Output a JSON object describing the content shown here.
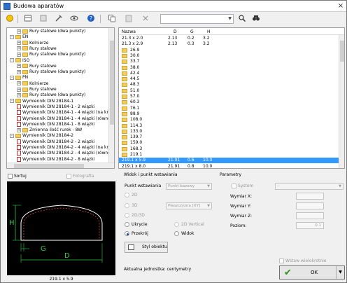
{
  "window": {
    "title": "Budowa aparatów",
    "close_glyph": "×"
  },
  "toolbar": {
    "icons": [
      "star-add-icon",
      "table-icon",
      "list-icon",
      "tools-icon",
      "view-icon",
      "help-icon",
      "copy-icon",
      "paste-icon",
      "delete-icon",
      "search-icon",
      "binoculars-icon"
    ],
    "combo_value": ""
  },
  "tree": {
    "items": [
      {
        "label": "Rury stalowe (dwa punkty)",
        "indent": 1,
        "type": "folder",
        "exp": "+"
      },
      {
        "label": "EN",
        "indent": 0,
        "type": "folder",
        "exp": "-"
      },
      {
        "label": "Kolnierze",
        "indent": 1,
        "type": "folder",
        "exp": "+"
      },
      {
        "label": "Rury stalowe",
        "indent": 1,
        "type": "folder",
        "exp": "+"
      },
      {
        "label": "Rury stalowe (dwa punkty)",
        "indent": 1,
        "type": "folder",
        "exp": "+"
      },
      {
        "label": "ISO",
        "indent": 0,
        "type": "folder",
        "exp": "-"
      },
      {
        "label": "Rury stalowe",
        "indent": 1,
        "type": "folder",
        "exp": "+"
      },
      {
        "label": "Rury stalowe (dwa punkty)",
        "indent": 1,
        "type": "folder",
        "exp": "+"
      },
      {
        "label": "PN",
        "indent": 0,
        "type": "folder",
        "exp": "-"
      },
      {
        "label": "Kolnierze",
        "indent": 1,
        "type": "folder",
        "exp": "+"
      },
      {
        "label": "Rury stalowe",
        "indent": 1,
        "type": "folder",
        "exp": "+"
      },
      {
        "label": "Rury stalowe (dwa punkty)",
        "indent": 1,
        "type": "folder",
        "exp": "+"
      },
      {
        "label": "Wymiennik DIN 28184-1",
        "indent": 0,
        "type": "folder",
        "exp": "-"
      },
      {
        "label": "Wymiennik DIN 28184-1 - 2 wiązki",
        "indent": 1,
        "type": "doc",
        "exp": ""
      },
      {
        "label": "Wymiennik DIN 28184-1 - 4 wiązki (na krzyż)",
        "indent": 1,
        "type": "doc",
        "exp": ""
      },
      {
        "label": "Wymiennik DIN 28184-1 - 4 wiązki (równoleg",
        "indent": 1,
        "type": "doc",
        "exp": ""
      },
      {
        "label": "Wymiennik DIN 28184-1 - 8 wiązki",
        "indent": 1,
        "type": "doc",
        "exp": ""
      },
      {
        "label": "Zmienna ilość rurek - 8W",
        "indent": 1,
        "type": "folder",
        "exp": "+"
      },
      {
        "label": "Wymiennik DIN 28184-2",
        "indent": 0,
        "type": "folder",
        "exp": "-"
      },
      {
        "label": "Wymiennik DIN 28184-2 - 2 wiązki",
        "indent": 1,
        "type": "doc",
        "exp": ""
      },
      {
        "label": "Wymiennik DIN 28184-2 - 4 wiązki (na krzyż)",
        "indent": 1,
        "type": "doc",
        "exp": ""
      },
      {
        "label": "Wymiennik DIN 28184-2 - 4 wiązki (równoleg",
        "indent": 1,
        "type": "doc",
        "exp": ""
      },
      {
        "label": "Wymiennik DIN 28184-2 - 8 wiązki",
        "indent": 1,
        "type": "doc",
        "exp": ""
      }
    ]
  },
  "grid": {
    "headers": {
      "name": "Nazwa",
      "d": "D",
      "g": "G",
      "h": "H"
    },
    "rows": [
      {
        "name": "21.3 x 2.0",
        "d": "2.13",
        "g": "0.2",
        "h": "3.2",
        "folder": false
      },
      {
        "name": "21.3 x 2.9",
        "d": "2.13",
        "g": "0.3",
        "h": "3.2",
        "folder": false
      },
      {
        "name": "26.9",
        "d": "",
        "g": "",
        "h": "",
        "folder": true
      },
      {
        "name": "30.0",
        "d": "",
        "g": "",
        "h": "",
        "folder": true
      },
      {
        "name": "33.7",
        "d": "",
        "g": "",
        "h": "",
        "folder": true
      },
      {
        "name": "38.0",
        "d": "",
        "g": "",
        "h": "",
        "folder": true
      },
      {
        "name": "42.4",
        "d": "",
        "g": "",
        "h": "",
        "folder": true
      },
      {
        "name": "44.5",
        "d": "",
        "g": "",
        "h": "",
        "folder": true
      },
      {
        "name": "48.3",
        "d": "",
        "g": "",
        "h": "",
        "folder": true
      },
      {
        "name": "51.0",
        "d": "",
        "g": "",
        "h": "",
        "folder": true
      },
      {
        "name": "57.0",
        "d": "",
        "g": "",
        "h": "",
        "folder": true
      },
      {
        "name": "60.3",
        "d": "",
        "g": "",
        "h": "",
        "folder": true
      },
      {
        "name": "76.1",
        "d": "",
        "g": "",
        "h": "",
        "folder": true
      },
      {
        "name": "88.9",
        "d": "",
        "g": "",
        "h": "",
        "folder": true
      },
      {
        "name": "108.0",
        "d": "",
        "g": "",
        "h": "",
        "folder": true
      },
      {
        "name": "114.3",
        "d": "",
        "g": "",
        "h": "",
        "folder": true
      },
      {
        "name": "133.0",
        "d": "",
        "g": "",
        "h": "",
        "folder": true
      },
      {
        "name": "139.7",
        "d": "",
        "g": "",
        "h": "",
        "folder": true
      },
      {
        "name": "159.0",
        "d": "",
        "g": "",
        "h": "",
        "folder": true
      },
      {
        "name": "168.3",
        "d": "",
        "g": "",
        "h": "",
        "folder": true
      },
      {
        "name": "219.1",
        "d": "",
        "g": "",
        "h": "",
        "folder": true
      },
      {
        "name": "219.1 x 5.9",
        "d": "21.91",
        "g": "0.6",
        "h": "10.0",
        "folder": false,
        "selected": true
      },
      {
        "name": "219.1 x 8.0",
        "d": "21.91",
        "g": "0.8",
        "h": "10.0",
        "folder": false
      }
    ]
  },
  "options": {
    "sort_label": "Sortuj",
    "photo_label": "Fotografia"
  },
  "preview": {
    "caption": "219.1 x 5.9",
    "dim_h": "H",
    "dim_g": "G",
    "dim_d": "D",
    "colors": {
      "outline": "#ffffff",
      "dims": "#2ecc40",
      "hidden": "#d94040"
    }
  },
  "insert": {
    "group_title": "Widok i punkt wstawiania",
    "point_label": "Punkt wstawiania",
    "point_value": "Punkt bazowy",
    "opt_2d": "2D",
    "opt_3d": "3D",
    "plane_value": "Płaszczyzna [XY]",
    "opt_2d3d": "2D/3D",
    "opt_hidden": "Ukrycie",
    "opt_2d_vertical": "2D Vertical",
    "opt_section": "Przekrój",
    "opt_view": "Widok",
    "style_button": "Styl obiektu"
  },
  "params": {
    "group_title": "Parametry",
    "system_label": "System",
    "system_value": "--",
    "dim_x_label": "Wymiar X:",
    "dim_y_label": "Wymiar Y:",
    "dim_z_label": "Wymiar Z:",
    "level_label": "Poziom:",
    "level_value": "0.1"
  },
  "footer": {
    "unit_text": "Aktualna jednostka: centymetry",
    "multi_insert_label": "Wstaw wielokrotnie",
    "ok_label": "OK",
    "dropdown_glyph": "▼"
  }
}
